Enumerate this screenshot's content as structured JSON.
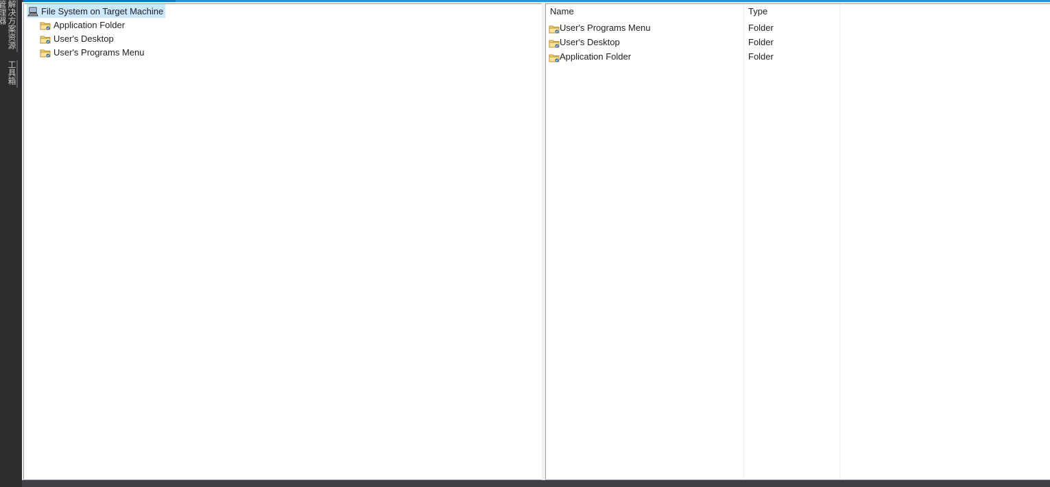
{
  "side_tabs": [
    {
      "label": "解决方案资源管理器"
    },
    {
      "label": "工具箱"
    }
  ],
  "tree": {
    "root_label": "File System on Target Machine",
    "children": [
      {
        "label": "Application Folder",
        "icon": "folder-icon"
      },
      {
        "label": "User's Desktop",
        "icon": "folder-icon"
      },
      {
        "label": "User's Programs Menu",
        "icon": "folder-icon"
      }
    ]
  },
  "list": {
    "columns": [
      "Name",
      "Type"
    ],
    "rows": [
      {
        "name": "User's Programs Menu",
        "type": "Folder",
        "icon": "folder-icon"
      },
      {
        "name": "User's Desktop",
        "type": "Folder",
        "icon": "folder-icon"
      },
      {
        "name": "Application Folder",
        "type": "Folder",
        "icon": "folder-icon"
      }
    ]
  },
  "colors": {
    "accent": "#007acc",
    "selection": "#cce8ff",
    "chrome_dark": "#2d2d30"
  }
}
